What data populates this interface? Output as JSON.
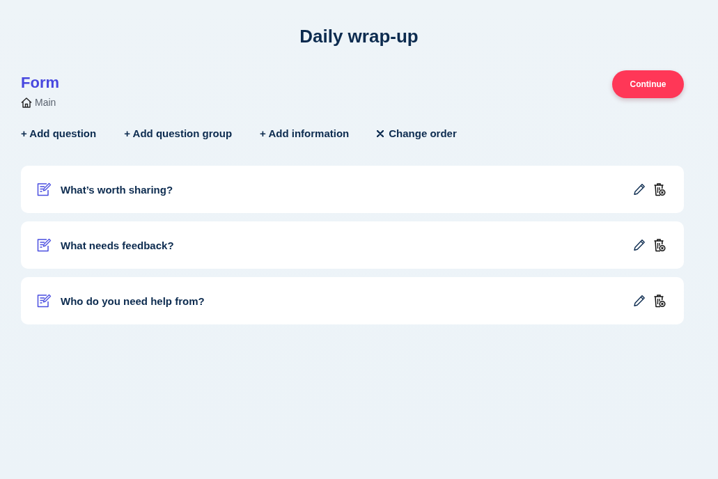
{
  "page": {
    "title": "Daily wrap-up"
  },
  "header": {
    "title": "Form",
    "breadcrumb": "Main",
    "button": "Continue"
  },
  "actions": [
    {
      "label": "+ Add question",
      "kind": "text"
    },
    {
      "label": "+ Add question group",
      "kind": "text"
    },
    {
      "label": "+ Add information",
      "kind": "text"
    },
    {
      "label": "Change order",
      "kind": "icon"
    }
  ],
  "questions": [
    {
      "text": "What’s worth sharing?"
    },
    {
      "text": "What needs feedback?"
    },
    {
      "text": "Who do you need help from?"
    }
  ]
}
